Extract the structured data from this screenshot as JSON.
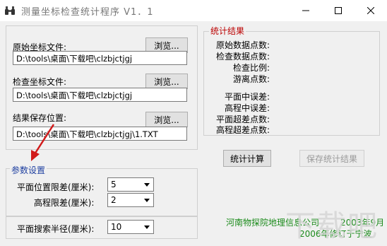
{
  "window": {
    "title": "测量坐标检查统计程序 V1．1",
    "icon": "binoculars-icon"
  },
  "files": {
    "source": {
      "label": "原始坐标文件:",
      "value": "D:\\tools\\桌面\\下载吧\\clzbjctjgj",
      "browse_label": "浏览..."
    },
    "check": {
      "label": "检查坐标文件:",
      "value": "D:\\tools\\桌面\\下载吧\\clzbjctjgj",
      "browse_label": "浏览..."
    },
    "result": {
      "label": "结果保存位置:",
      "value": "D:\\tools\\桌面\\下载吧\\clzbjctjgj\\1.TXT",
      "browse_label": "浏览..."
    }
  },
  "params": {
    "title": "参数设置",
    "plane_label": "平面位置限差(厘米):",
    "plane_value": "5",
    "height_label": "高程限差(厘米):",
    "height_value": "2",
    "radius_label": "平面搜索半径(厘米):",
    "radius_value": "10"
  },
  "stats": {
    "title": "统计结果",
    "items": [
      "原始数据点数:",
      "检查数据点数:",
      "检查比例:",
      "游离点数:",
      "平面中误差:",
      "高程中误差:",
      "平面超差点数:",
      "高程超差点数:"
    ]
  },
  "actions": {
    "compute_label": "统计计算",
    "save_label": "保存统计结果"
  },
  "credits": {
    "org": "河南物探院地理信息公司",
    "date": "2003年9月",
    "revised": "2006年修订于宁波"
  },
  "watermark": "下载吧",
  "colors": {
    "accent_red": "#b00000",
    "params_blue": "#1e3fa0",
    "credit_green": "#1a8a1a",
    "arrow_red": "#d11a1a"
  }
}
